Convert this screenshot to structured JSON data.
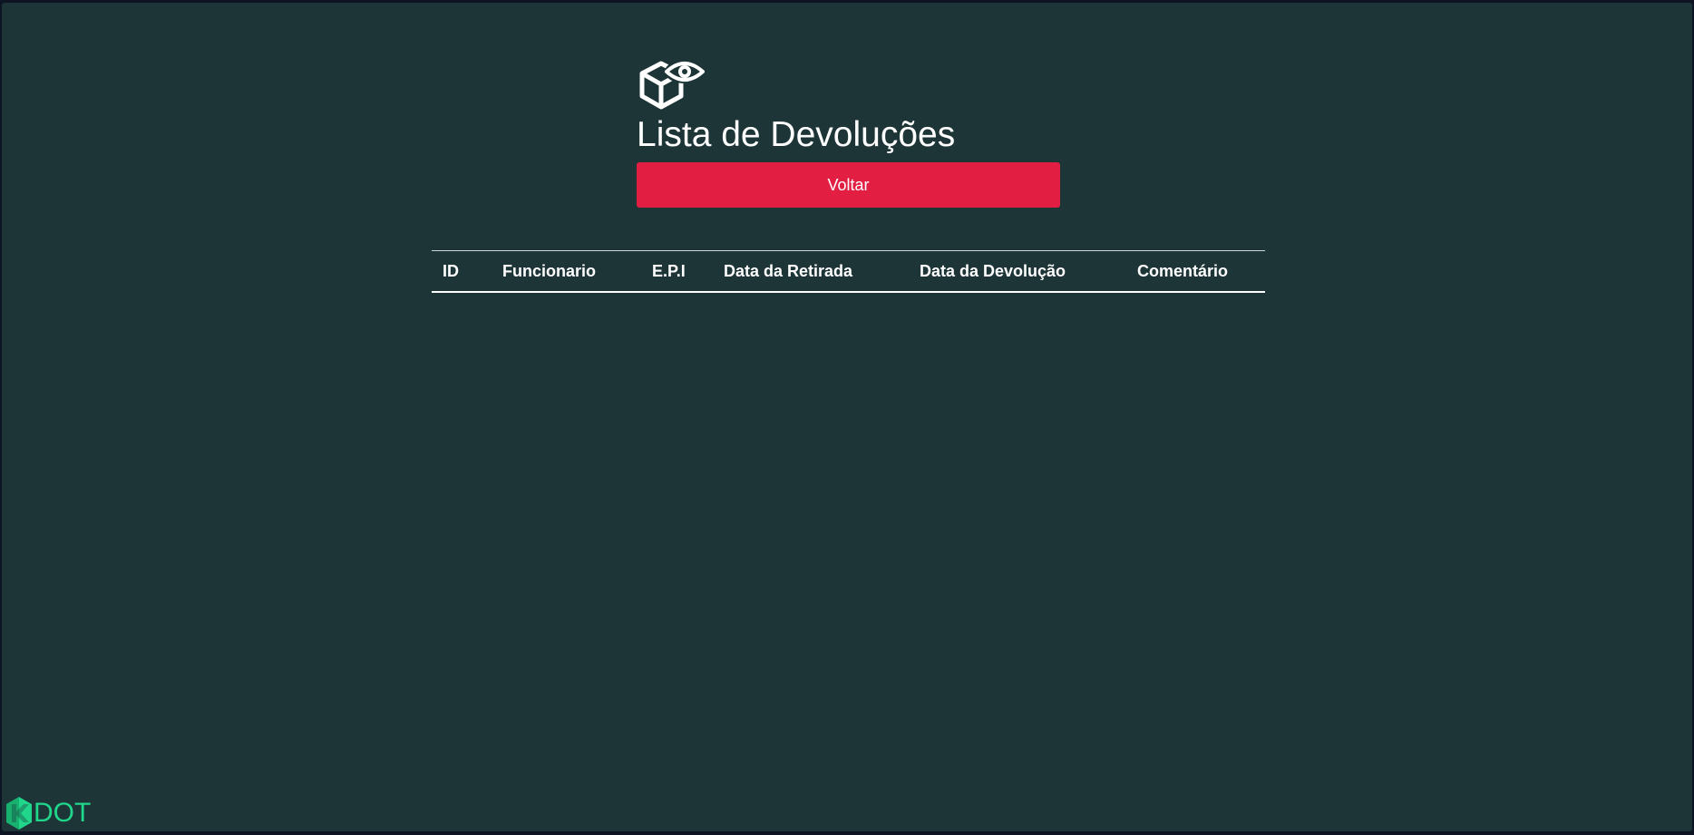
{
  "page": {
    "title": "Lista de Devoluções",
    "header_icon": "box-eye-icon"
  },
  "actions": {
    "back_label": "Voltar"
  },
  "table": {
    "columns": [
      "ID",
      "Funcionario",
      "E.P.I",
      "Data da Retirada",
      "Data da Devolução",
      "Comentário"
    ],
    "rows": []
  },
  "branding": {
    "logo_text": "DOT",
    "logo_icon": "kdot-logo-icon"
  },
  "colors": {
    "background": "#1e3538",
    "button": "#e21f43",
    "logo": "#1fd68a",
    "text": "#ffffff"
  }
}
